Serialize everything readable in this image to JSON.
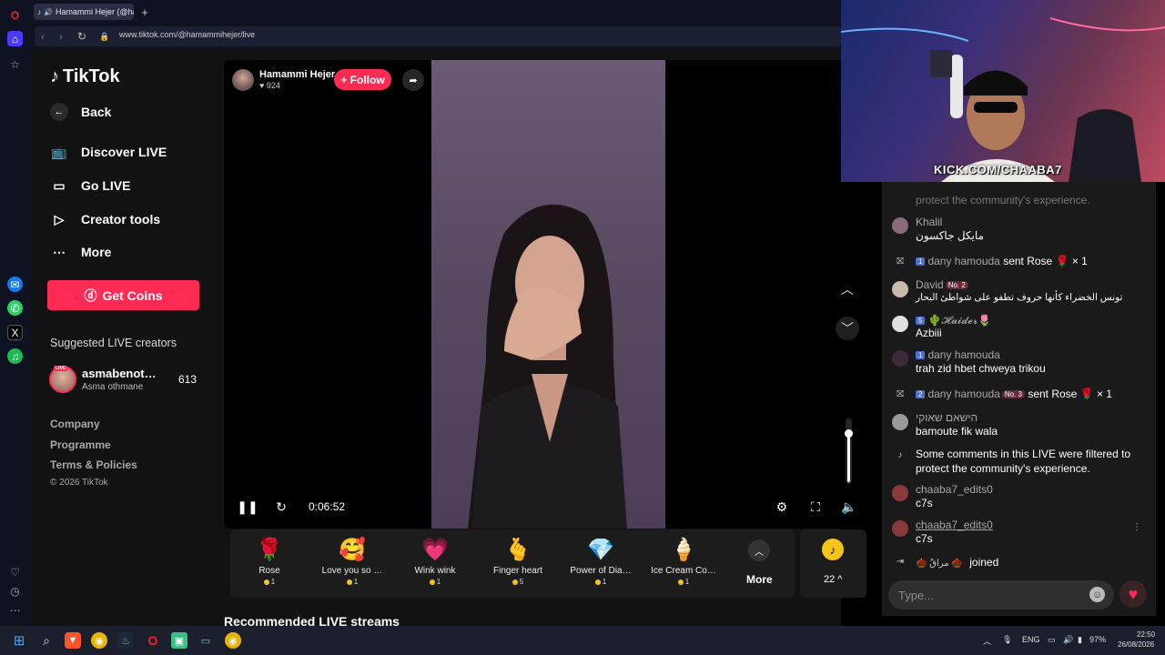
{
  "browser": {
    "tab_title": "Hamammi Hejer (@ha…",
    "new_tab": "+",
    "url": "www.tiktok.com/@hamammihejer/live"
  },
  "tiktok": {
    "logo": "TikTok",
    "back": "Back",
    "nav": [
      {
        "label": "Discover LIVE",
        "icon": "live-tv-icon"
      },
      {
        "label": "Go LIVE",
        "icon": "video-camera-icon"
      },
      {
        "label": "Creator tools",
        "icon": "creator-tools-icon"
      },
      {
        "label": "More",
        "icon": "more-dots-icon"
      }
    ],
    "get_coins": "Get Coins",
    "suggested_title": "Suggested LIVE creators",
    "suggested": {
      "name": "asmabenot…",
      "sub": "Asma othmane",
      "count": "613",
      "badge": "LIVE"
    },
    "footer": [
      "Company",
      "Programme",
      "Terms & Policies"
    ],
    "copyright": "© 2026 TikTok"
  },
  "player": {
    "host_name": "Hamammi Hejer",
    "host_likes": "♥ 924",
    "follow": "+ Follow",
    "time": "0:06:52",
    "volume_level": 0.8
  },
  "gifts": [
    {
      "name": "Rose",
      "price": "1",
      "emoji": "🌹"
    },
    {
      "name": "Love you so …",
      "price": "1",
      "emoji": "🥰"
    },
    {
      "name": "Wink wink",
      "price": "1",
      "emoji": "💗"
    },
    {
      "name": "Finger heart",
      "price": "5",
      "emoji": "🫰"
    },
    {
      "name": "Power of Dia…",
      "price": "1",
      "emoji": "💎"
    },
    {
      "name": "Ice Cream Co…",
      "price": "1",
      "emoji": "🍦"
    }
  ],
  "gift_more": "More",
  "coins": "22 ^",
  "recommended_title": "Recommended LIVE streams",
  "webcam_text": "KICK.COM/CHAABA7",
  "chat": {
    "partial_top": "protect the community's experience.",
    "messages": [
      {
        "user": "Khalil",
        "text": "مايكل جاكسون"
      },
      {
        "level": "1",
        "user": "dany hamouda",
        "text": "sent Rose 🌹 × 1"
      },
      {
        "user": "David",
        "rank": "No. 2",
        "text": "تونس الخضراء كأنها حروف تطفو على شواطئ البحار"
      },
      {
        "level": "5",
        "user": "🌵𝓗𝓪𝓲𝓭𝓮𝓻🌷",
        "text": "Azbiii"
      },
      {
        "level": "1",
        "user": "dany hamouda",
        "text": "trah zid hbet chweya trikou"
      },
      {
        "level": "2",
        "user": "dany hamouda",
        "rank": "No. 3",
        "text": "sent Rose 🌹 × 1"
      },
      {
        "user": "הישאם שאוקי",
        "text": "bamoute fik wala"
      },
      {
        "text": "Some comments in this LIVE were filtered to",
        "text2": "protect the community's experience."
      },
      {
        "user": "chaaba7_edits0",
        "text": "c7s"
      },
      {
        "user": "chaaba7_edits0",
        "text": "c7s"
      },
      {
        "user": "🌰 مراقٌ 🌰",
        "text": "joined"
      }
    ],
    "input_placeholder": "Type..."
  },
  "taskbar": {
    "lang": "ENG",
    "battery": "97%",
    "time": "22:50",
    "date": "26/08/2026"
  }
}
